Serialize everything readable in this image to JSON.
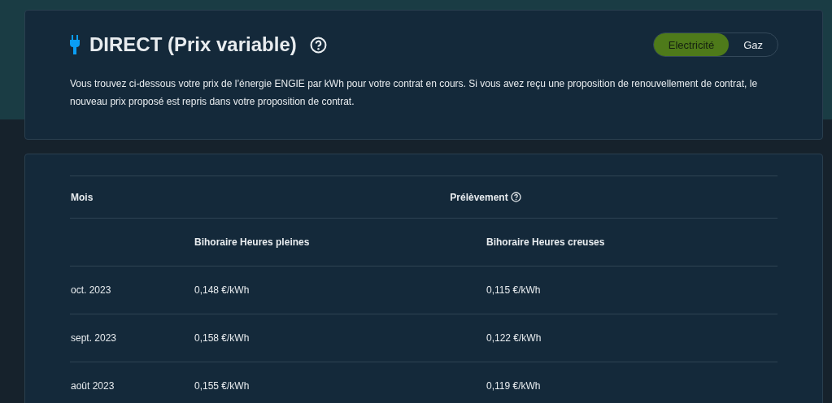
{
  "header": {
    "title": "DIRECT (Prix variable)",
    "toggle": [
      {
        "label": "Electricité",
        "selected": true
      },
      {
        "label": "Gaz",
        "selected": false
      }
    ],
    "description": "Vous trouvez ci-dessous votre prix de l’énergie ENGIE par kWh pour votre contrat en cours. Si vous avez reçu une proposition de renouvellement de contrat, le nouveau prix proposé est repris dans votre proposition de contrat."
  },
  "table": {
    "columns": [
      "Mois",
      "Prélèvement"
    ],
    "subcolumns": [
      "Bihoraire Heures pleines",
      "Bihoraire Heures creuses"
    ],
    "rows": [
      {
        "month": "oct. 2023",
        "peak": "0,148 €/kWh",
        "offpeak": "0,115 €/kWh"
      },
      {
        "month": "sept. 2023",
        "peak": "0,158 €/kWh",
        "offpeak": "0,122 €/kWh"
      },
      {
        "month": "août 2023",
        "peak": "0,155 €/kWh",
        "offpeak": "0,119 €/kWh"
      }
    ]
  }
}
